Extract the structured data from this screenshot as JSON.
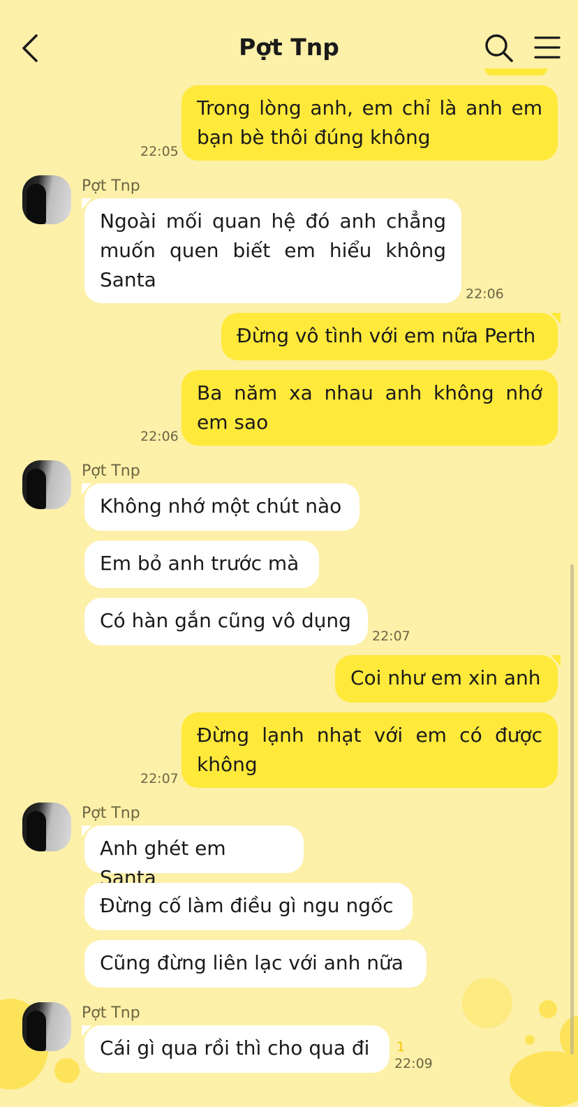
{
  "header": {
    "title": "Pợt Tnp",
    "icons": [
      "chevron-left-icon",
      "search-icon",
      "menu-icon"
    ]
  },
  "colors": {
    "background": "#fdf0a8",
    "own_bubble": "#ffe93b",
    "other_bubble": "#ffffff",
    "unread_count": "#f3c600"
  },
  "messages": [
    {
      "from": "me",
      "text": "Trong lòng anh, em chỉ là anh em bạn bè thôi đúng không",
      "time": "22:05"
    },
    {
      "from": "Pợt Tnp",
      "sender_label": "Pợt Tnp",
      "text": "Ngoài mối quan hệ đó anh chẳng muốn quen biết em hiểu không Santa",
      "time": "22:06"
    },
    {
      "from": "me",
      "text": "Đừng vô tình với em nữa Perth"
    },
    {
      "from": "me",
      "text": "Ba năm xa nhau anh không nhớ em sao",
      "time": "22:06"
    },
    {
      "from": "Pợt Tnp",
      "sender_label": "Pợt Tnp",
      "text": "Không nhớ một chút nào"
    },
    {
      "from": "Pợt Tnp",
      "text": "Em bỏ anh trước mà"
    },
    {
      "from": "Pợt Tnp",
      "text": "Có hàn gắn cũng vô dụng",
      "time": "22:07"
    },
    {
      "from": "me",
      "text": "Coi như em xin anh"
    },
    {
      "from": "me",
      "text": "Đừng lạnh nhạt với em có được không",
      "time": "22:07"
    },
    {
      "from": "Pợt Tnp",
      "sender_label": "Pợt Tnp",
      "text": "Anh ghét em Santa"
    },
    {
      "from": "Pợt Tnp",
      "text": "Đừng cố làm điều gì ngu ngốc"
    },
    {
      "from": "Pợt Tnp",
      "text": "Cũng đừng liên lạc với anh nữa"
    },
    {
      "from": "Pợt Tnp",
      "sender_label": "Pợt Tnp",
      "text": "Cái gì qua rồi thì cho qua đi",
      "time": "22:09",
      "unread": "1"
    }
  ]
}
